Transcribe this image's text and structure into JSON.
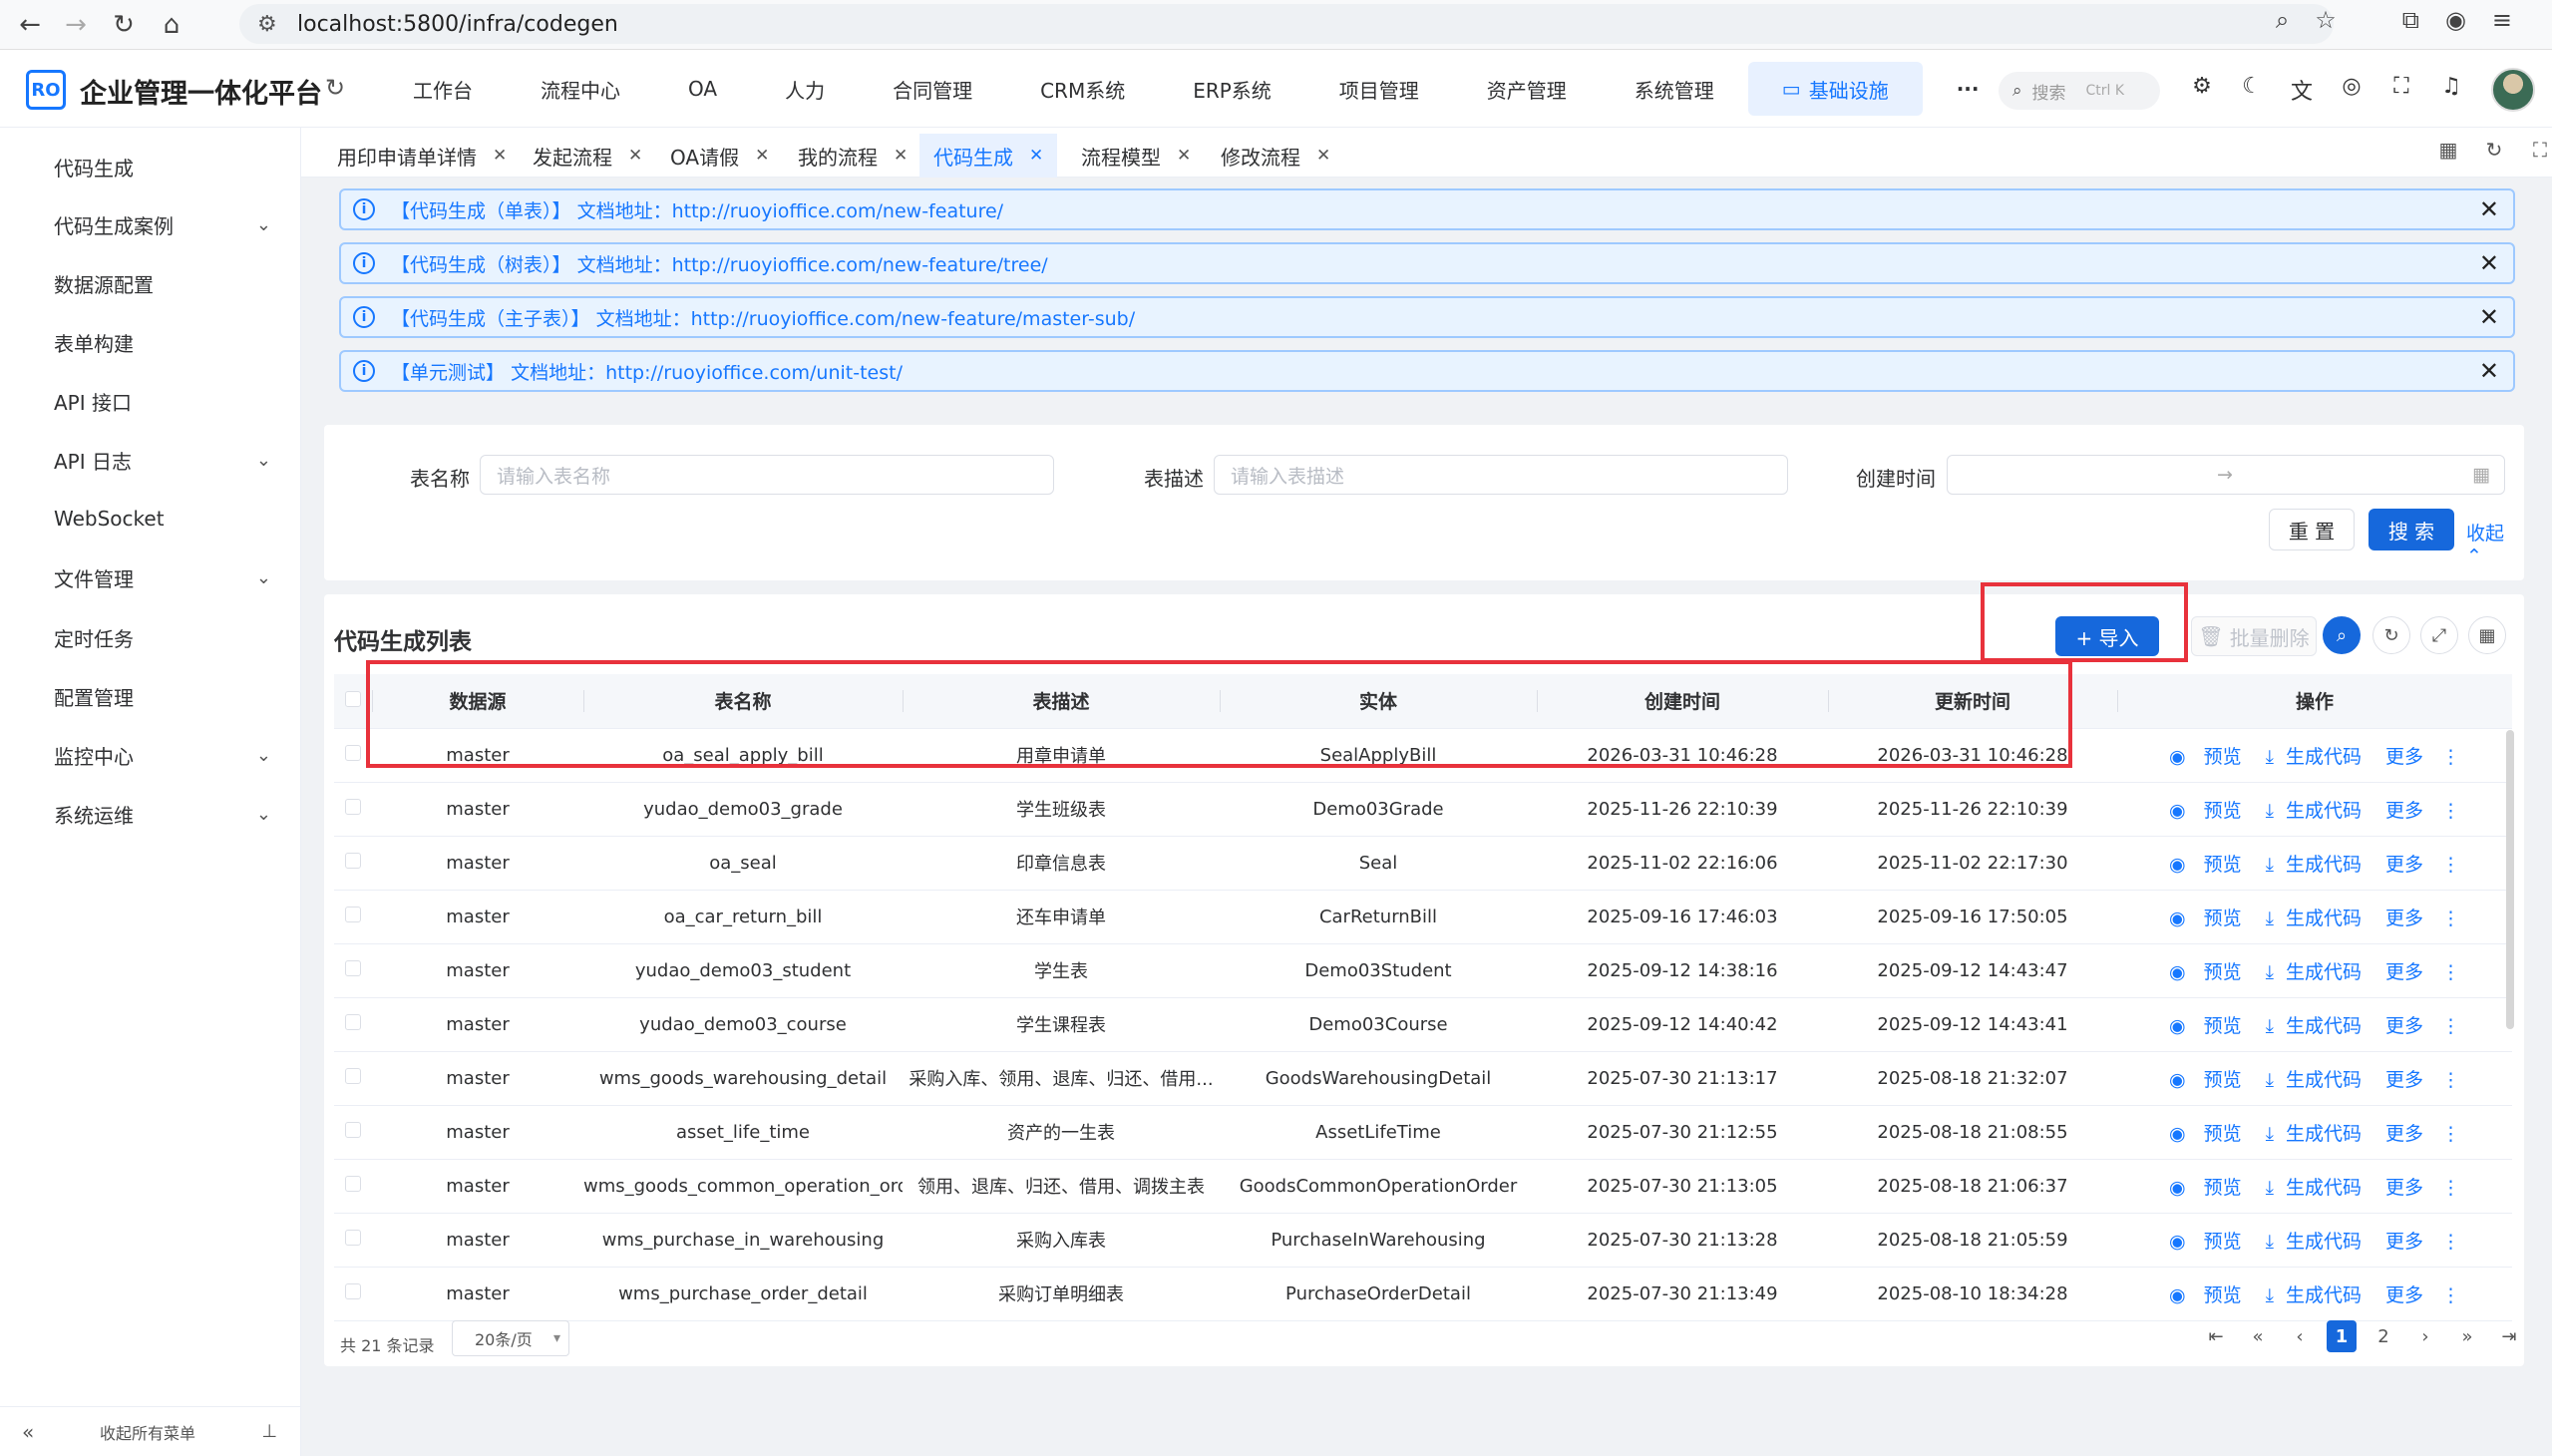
{
  "browser": {
    "url": "localhost:5800/infra/codegen"
  },
  "app": {
    "logo_text": "RO",
    "title": "企业管理一体化平台",
    "menu": [
      "工作台",
      "流程中心",
      "OA",
      "人力",
      "合同管理",
      "CRM系统",
      "ERP系统",
      "项目管理",
      "资产管理",
      "系统管理",
      "基础设施"
    ],
    "active_menu": "基础设施",
    "more": "···",
    "search_placeholder": "搜索",
    "search_shortcut": "Ctrl K"
  },
  "sidebar": {
    "items": [
      {
        "label": "代码生成",
        "has_children": false
      },
      {
        "label": "代码生成案例",
        "has_children": true
      },
      {
        "label": "数据源配置",
        "has_children": false
      },
      {
        "label": "表单构建",
        "has_children": false
      },
      {
        "label": "API 接口",
        "has_children": false
      },
      {
        "label": "API 日志",
        "has_children": true
      },
      {
        "label": "WebSocket",
        "has_children": false
      },
      {
        "label": "文件管理",
        "has_children": true
      },
      {
        "label": "定时任务",
        "has_children": false
      },
      {
        "label": "配置管理",
        "has_children": false
      },
      {
        "label": "监控中心",
        "has_children": true
      },
      {
        "label": "系统运维",
        "has_children": true
      }
    ],
    "collapse_label": "收起所有菜单"
  },
  "tabs": [
    {
      "label": "用印申请单详情",
      "active": false
    },
    {
      "label": "发起流程",
      "active": false
    },
    {
      "label": "OA请假",
      "active": false
    },
    {
      "label": "我的流程",
      "active": false
    },
    {
      "label": "代码生成",
      "active": true
    },
    {
      "label": "流程模型",
      "active": false
    },
    {
      "label": "修改流程",
      "active": false
    }
  ],
  "alerts": [
    {
      "title": "【代码生成（单表）】",
      "label": "文档地址：",
      "url": "http://ruoyioffice.com/new-feature/"
    },
    {
      "title": "【代码生成（树表）】",
      "label": "文档地址：",
      "url": "http://ruoyioffice.com/new-feature/tree/"
    },
    {
      "title": "【代码生成（主子表）】",
      "label": "文档地址：",
      "url": "http://ruoyioffice.com/new-feature/master-sub/"
    },
    {
      "title": "【单元测试】",
      "label": "文档地址：",
      "url": "http://ruoyioffice.com/unit-test/"
    }
  ],
  "search_form": {
    "table_name_label": "表名称",
    "table_name_placeholder": "请输入表名称",
    "table_desc_label": "表描述",
    "table_desc_placeholder": "请输入表描述",
    "created_label": "创建时间",
    "range_separator": "→",
    "reset_label": "重 置",
    "search_label": "搜 索",
    "collapse_label": "收起"
  },
  "list": {
    "title": "代码生成列表",
    "import_label": "+ 导入",
    "batch_delete_label": "批量删除",
    "columns": [
      "数据源",
      "表名称",
      "表描述",
      "实体",
      "创建时间",
      "更新时间",
      "操作"
    ],
    "rows": [
      [
        "master",
        "oa_seal_apply_bill",
        "用章申请单",
        "SealApplyBill",
        "2026-03-31 10:46:28",
        "2026-03-31 10:46:28"
      ],
      [
        "master",
        "yudao_demo03_grade",
        "学生班级表",
        "Demo03Grade",
        "2025-11-26 22:10:39",
        "2025-11-26 22:10:39"
      ],
      [
        "master",
        "oa_seal",
        "印章信息表",
        "Seal",
        "2025-11-02 22:16:06",
        "2025-11-02 22:17:30"
      ],
      [
        "master",
        "oa_car_return_bill",
        "还车申请单",
        "CarReturnBill",
        "2025-09-16 17:46:03",
        "2025-09-16 17:50:05"
      ],
      [
        "master",
        "yudao_demo03_student",
        "学生表",
        "Demo03Student",
        "2025-09-12 14:38:16",
        "2025-09-12 14:43:47"
      ],
      [
        "master",
        "yudao_demo03_course",
        "学生课程表",
        "Demo03Course",
        "2025-09-12 14:40:42",
        "2025-09-12 14:43:41"
      ],
      [
        "master",
        "wms_goods_warehousing_detail",
        "采购入库、领用、退库、归还、借用...",
        "GoodsWarehousingDetail",
        "2025-07-30 21:13:17",
        "2025-08-18 21:32:07"
      ],
      [
        "master",
        "asset_life_time",
        "资产的一生表",
        "AssetLifeTime",
        "2025-07-30 21:12:55",
        "2025-08-18 21:08:55"
      ],
      [
        "master",
        "wms_goods_common_operation_order",
        "领用、退库、归还、借用、调拨主表",
        "GoodsCommonOperationOrder",
        "2025-07-30 21:13:05",
        "2025-08-18 21:06:37"
      ],
      [
        "master",
        "wms_purchase_in_warehousing",
        "采购入库表",
        "PurchaseInWarehousing",
        "2025-07-30 21:13:28",
        "2025-08-18 21:05:59"
      ],
      [
        "master",
        "wms_purchase_order_detail",
        "采购订单明细表",
        "PurchaseOrderDetail",
        "2025-07-30 21:13:49",
        "2025-08-10 18:34:28"
      ]
    ],
    "actions": {
      "preview": "预览",
      "generate": "生成代码",
      "more": "更多"
    }
  },
  "pagination": {
    "total_text": "共 21 条记录",
    "page_size": "20条/页",
    "pages": [
      "1",
      "2"
    ],
    "current": "1"
  },
  "colors": {
    "primary": "#1668dc",
    "highlight_box": "#e8323c",
    "alert_bg": "#e8f3ff"
  }
}
